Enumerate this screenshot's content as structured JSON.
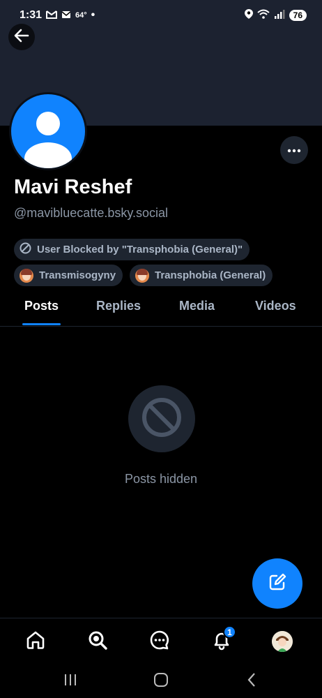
{
  "status_bar": {
    "time": "1:31",
    "temperature": "64°",
    "battery": "76"
  },
  "profile": {
    "display_name": "Mavi Reshef",
    "handle": "@mavibluecatte.bsky.social"
  },
  "labels": [
    {
      "text": "User Blocked by \"Transphobia (General)\"",
      "icon": "block-icon"
    },
    {
      "text": "Transmisogyny",
      "icon": "labeler-avatar"
    },
    {
      "text": "Transphobia (General)",
      "icon": "labeler-avatar"
    }
  ],
  "tabs": [
    {
      "label": "Posts",
      "active": true
    },
    {
      "label": "Replies",
      "active": false
    },
    {
      "label": "Media",
      "active": false
    },
    {
      "label": "Videos",
      "active": false
    }
  ],
  "content": {
    "empty_message": "Posts hidden",
    "icon": "block-icon"
  },
  "bottom_nav": {
    "items": [
      "home-icon",
      "search-icon",
      "chat-icon",
      "notifications-icon",
      "profile-avatar"
    ],
    "notification_count": "1"
  },
  "colors": {
    "accent": "#1083fe",
    "background": "#000000",
    "banner": "#1c2230",
    "chip_bg": "#1e2530",
    "muted_text": "#8b96a5"
  }
}
